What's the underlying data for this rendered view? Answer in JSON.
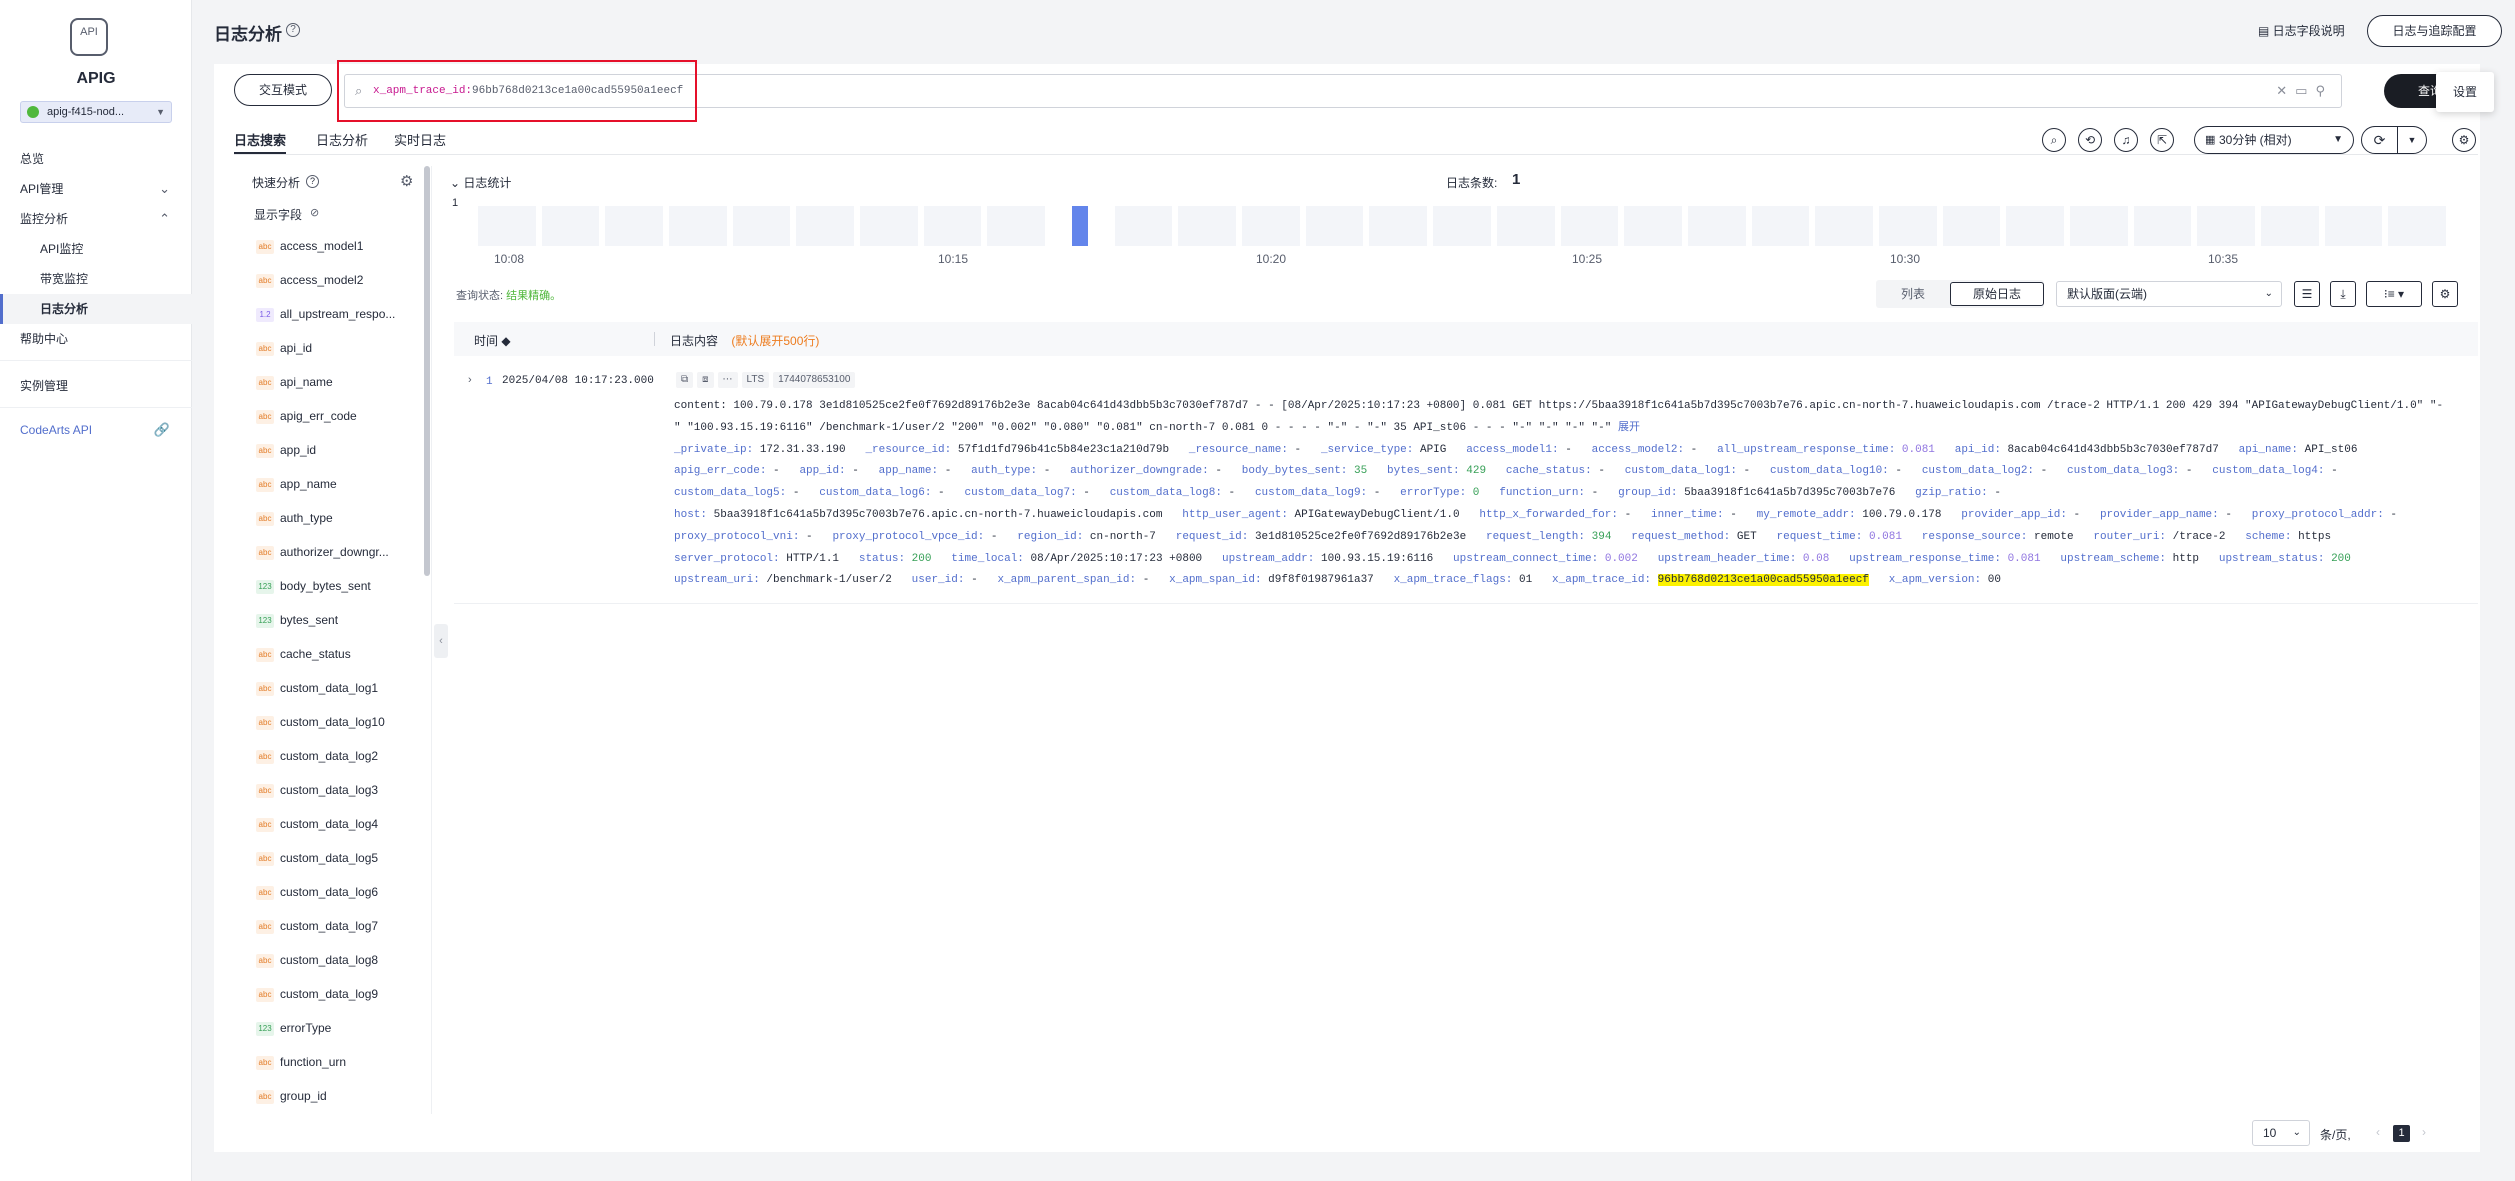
{
  "sidebar": {
    "logo_text": "API",
    "title": "APIG",
    "instance": "apig-f415-nod...",
    "items": [
      {
        "label": "总览"
      },
      {
        "label": "API管理"
      },
      {
        "label": "监控分析"
      },
      {
        "label": "API监控"
      },
      {
        "label": "带宽监控"
      },
      {
        "label": "日志分析"
      },
      {
        "label": "帮助中心"
      },
      {
        "label": "实例管理"
      },
      {
        "label": "CodeArts API"
      }
    ]
  },
  "header": {
    "title": "日志分析",
    "doc_link": "日志字段说明",
    "config_button": "日志与追踪配置"
  },
  "search": {
    "mode_button": "交互模式",
    "query_key": "x_apm_trace_id:",
    "query_value": "96bb768d0213ce1a00cad55950a1eecf",
    "query_button": "查询",
    "tooltip": "设置"
  },
  "tabs": [
    {
      "label": "日志搜索"
    },
    {
      "label": "日志分析"
    },
    {
      "label": "实时日志"
    }
  ],
  "toolbar": {
    "time_range": "30分钟 (相对)"
  },
  "fields_panel": {
    "title": "快速分析",
    "show_fields": "显示字段",
    "fields": [
      {
        "type": "abc",
        "name": "access_model1"
      },
      {
        "type": "abc",
        "name": "access_model2"
      },
      {
        "type": "1.2",
        "name": "all_upstream_respo..."
      },
      {
        "type": "abc",
        "name": "api_id"
      },
      {
        "type": "abc",
        "name": "api_name"
      },
      {
        "type": "abc",
        "name": "apig_err_code"
      },
      {
        "type": "abc",
        "name": "app_id"
      },
      {
        "type": "abc",
        "name": "app_name"
      },
      {
        "type": "abc",
        "name": "auth_type"
      },
      {
        "type": "abc",
        "name": "authorizer_downgr..."
      },
      {
        "type": "123",
        "name": "body_bytes_sent"
      },
      {
        "type": "123",
        "name": "bytes_sent"
      },
      {
        "type": "abc",
        "name": "cache_status"
      },
      {
        "type": "abc",
        "name": "custom_data_log1"
      },
      {
        "type": "abc",
        "name": "custom_data_log10"
      },
      {
        "type": "abc",
        "name": "custom_data_log2"
      },
      {
        "type": "abc",
        "name": "custom_data_log3"
      },
      {
        "type": "abc",
        "name": "custom_data_log4"
      },
      {
        "type": "abc",
        "name": "custom_data_log5"
      },
      {
        "type": "abc",
        "name": "custom_data_log6"
      },
      {
        "type": "abc",
        "name": "custom_data_log7"
      },
      {
        "type": "abc",
        "name": "custom_data_log8"
      },
      {
        "type": "abc",
        "name": "custom_data_log9"
      },
      {
        "type": "123",
        "name": "errorType"
      },
      {
        "type": "abc",
        "name": "function_urn"
      },
      {
        "type": "abc",
        "name": "group_id"
      }
    ]
  },
  "stats": {
    "label": "日志统计",
    "count_label": "日志条数:",
    "count_value": "1",
    "y_max": "1",
    "ticks": [
      "10:08",
      "10:15",
      "10:20",
      "10:25",
      "10:30",
      "10:35"
    ],
    "bucket_count": 31,
    "hit_bucket": 9
  },
  "results": {
    "status_label": "查询状态:",
    "status_value": "结果精确。",
    "view_list": "列表",
    "view_raw": "原始日志",
    "layout": "默认版面(云端)",
    "col_time": "时间",
    "col_content": "日志内容",
    "col_hint": "(默认展开500行)"
  },
  "log": {
    "index": "1",
    "time": "2025/04/08 10:17:23.000",
    "tag_lts": "LTS",
    "tag_ts": "1744078653100",
    "content": "content: 100.79.0.178 3e1d810525ce2fe0f7692d89176b2e3e 8acab04c641d43dbb5b3c7030ef787d7 - - [08/Apr/2025:10:17:23 +0800] 0.081 GET https://5baa3918f1c641a5b7d395c7003b7e76.apic.cn-north-7.huaweicloudapis.com /trace-2 HTTP/1.1 200 429 394 \"APIGatewayDebugClient/1.0\" \"-",
    "content2": "\" \"100.93.15.19:6116\" /benchmark-1/user/2 \"200\" \"0.002\" \"0.080\" \"0.081\" cn-north-7 0.081 0 - - - - \"-\" - \"-\" 35 API_st06 - - - \"-\" \"-\" \"-\" \"-\"",
    "expand": "展开",
    "trace_id": "96bb768d0213ce1a00cad55950a1eecf"
  },
  "pagination": {
    "size": "10",
    "per_page": "条/页,",
    "current": "1"
  }
}
